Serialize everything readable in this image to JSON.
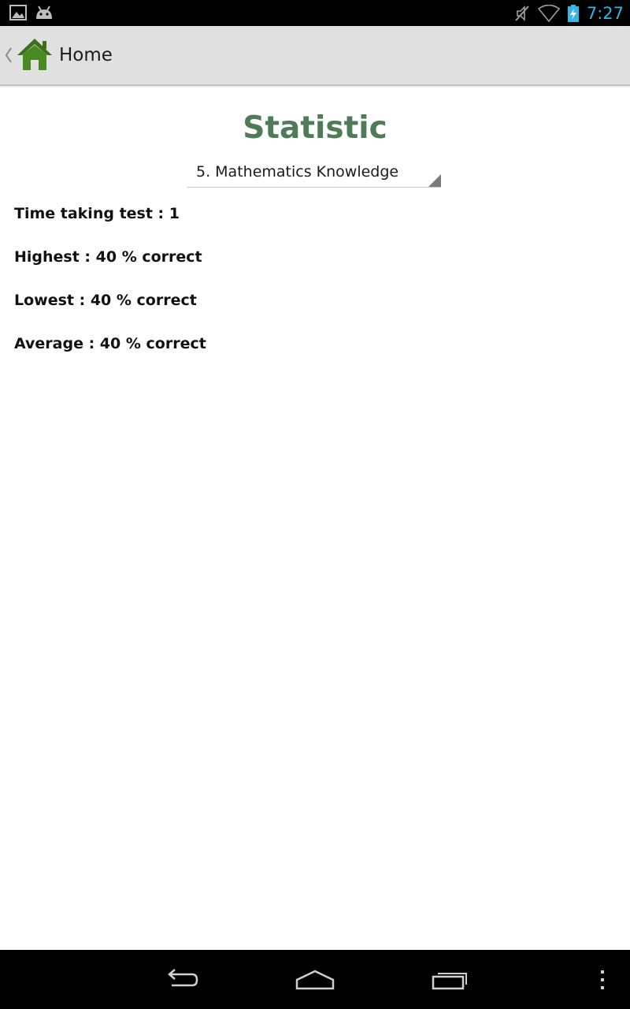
{
  "status_bar": {
    "clock": "7:27",
    "icons": [
      "gallery-icon",
      "android-icon",
      "muted-icon",
      "wifi-icon",
      "battery-charging-icon"
    ],
    "clock_color": "#33b5e5"
  },
  "action_bar": {
    "title": "Home",
    "icon": "home-icon",
    "icon_color": "#3d6e1c"
  },
  "page": {
    "title": "Statistic",
    "title_color": "#4f7c57"
  },
  "subject_spinner": {
    "selected": "5. Mathematics Knowledge"
  },
  "stats": {
    "times": "Time taking test : 1",
    "highest": "Highest : 40 % correct",
    "lowest": "Lowest : 40 % correct",
    "average": "Average : 40 % correct"
  },
  "nav_bar": {
    "buttons": [
      "back-icon",
      "home-icon",
      "recents-icon",
      "menu-icon"
    ]
  }
}
